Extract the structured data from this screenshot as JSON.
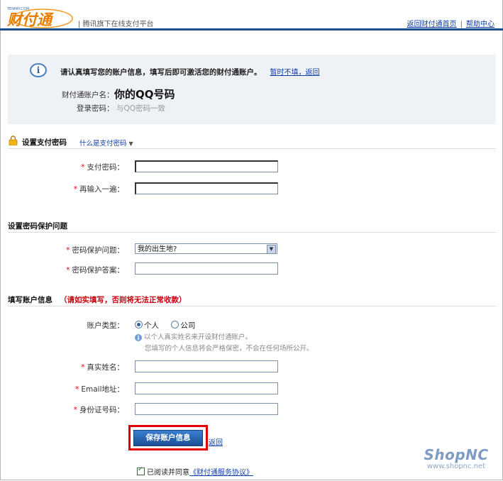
{
  "header": {
    "logo_small": "TENPAY.COM",
    "logo_text": "财付通",
    "tagline": "腾讯旗下在线支付平台",
    "links": [
      {
        "label": "返回财付通首页"
      },
      {
        "label": "帮助中心"
      }
    ],
    "link_sep": "|"
  },
  "info": {
    "message": "请认真填写您的账户信息，填写后即可激活您的财付通账户。",
    "later_link": "暂时不填，返回",
    "account_label": "财付通账户名：",
    "account_value": "你的QQ号码",
    "password_label": "登录密码：",
    "password_hint": "与QQ密码一致"
  },
  "section_pay": {
    "title": "设置支付密码",
    "help_link": "什么是支付密码",
    "fields": [
      {
        "label": "支付密码：",
        "required": "*"
      },
      {
        "label": "再输入一遍：",
        "required": "*"
      }
    ]
  },
  "section_security": {
    "title": "设置密码保护问题",
    "question_label": "密码保护问题：",
    "question_value": "我的出生地?",
    "answer_label": "密码保护答案：",
    "required": "*"
  },
  "section_account": {
    "title": "填写账户信息",
    "warning": "（请如实填写，否则将无法正常收款）",
    "type_label": "账户类型：",
    "type_options": [
      "个人",
      "公司"
    ],
    "note1": "以个人真实姓名来开设财付通账户。",
    "note2": "您填写的个人信息将会严格保密，不会在任何场所公开。",
    "fields": [
      {
        "label": "真实姓名：",
        "required": "*"
      },
      {
        "label": "Email地址：",
        "required": "*"
      },
      {
        "label": "身份证号码：",
        "required": "*"
      }
    ]
  },
  "actions": {
    "save_label": "保存账户信息",
    "back_label": "返回",
    "agree_text": "已阅读并同意",
    "agreement_link": "《财付通服务协议》"
  },
  "watermark": {
    "brand": "ShopNC",
    "url": "www.shopnc.net"
  },
  "colors": {
    "header_bar": "#1d4f8e",
    "link": "#0f3fa8",
    "warning": "#c7000b",
    "highlight_outline": "#e30000"
  }
}
